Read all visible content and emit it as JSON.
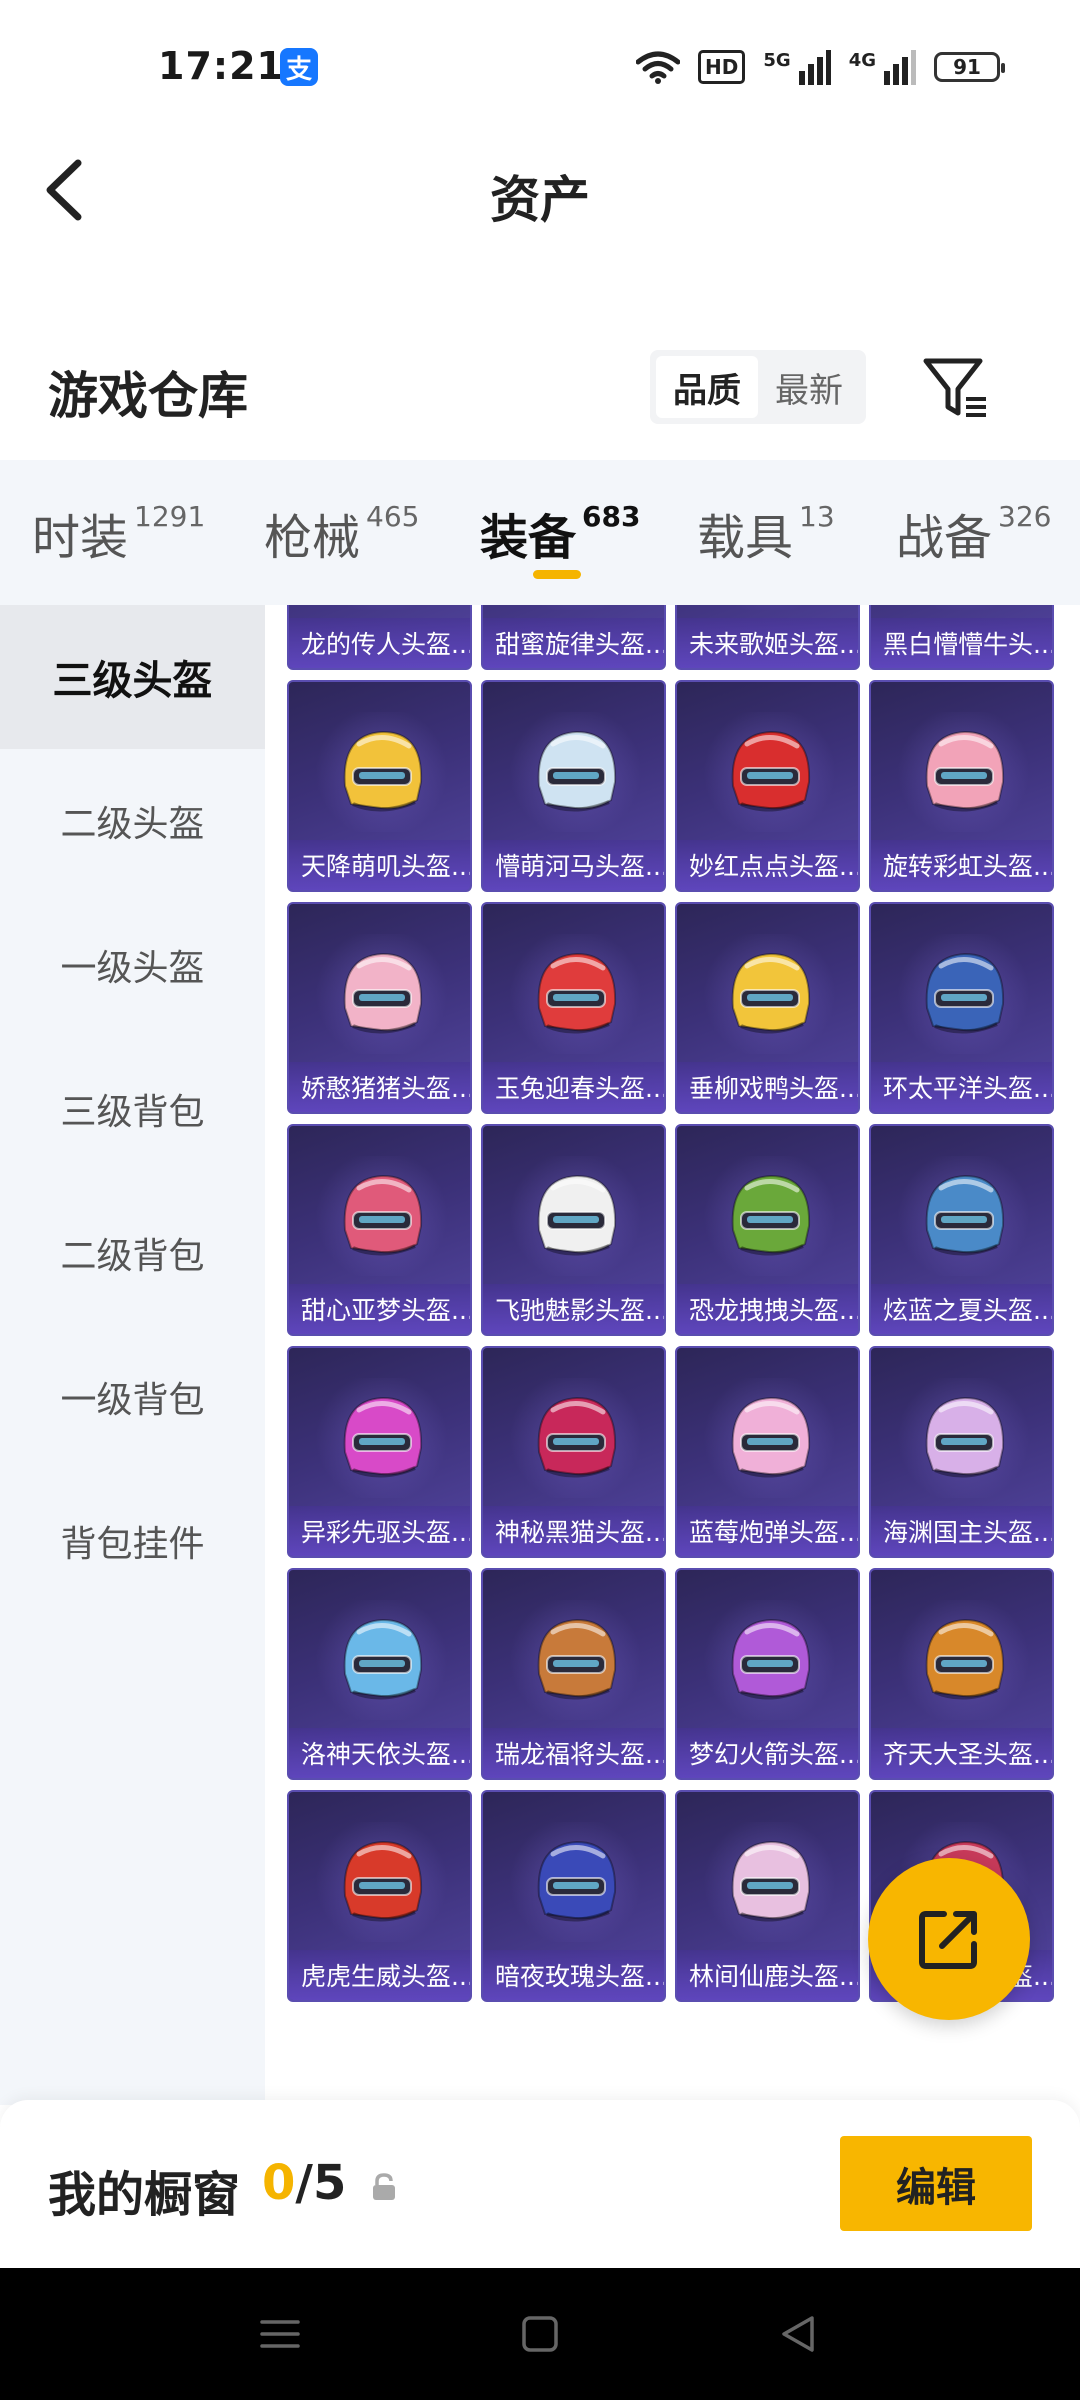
{
  "status_bar": {
    "time": "17:21",
    "alipay_label": "支",
    "hd_label": "HD",
    "net_5g": "5G",
    "net_4g": "4G",
    "battery": "91"
  },
  "header": {
    "title": "资产"
  },
  "section": {
    "title": "游戏仓库",
    "sort_options": [
      "品质",
      "最新"
    ],
    "active_sort": "品质"
  },
  "category_tabs": [
    {
      "name": "时装",
      "count": "1291"
    },
    {
      "name": "枪械",
      "count": "465"
    },
    {
      "name": "装备",
      "count": "683",
      "active": true
    },
    {
      "name": "载具",
      "count": "13"
    },
    {
      "name": "战备",
      "count": "326"
    }
  ],
  "sidebar": {
    "items": [
      "三级头盔",
      "二级头盔",
      "一级头盔",
      "三级背包",
      "二级背包",
      "一级背包",
      "背包挂件"
    ],
    "active": "三级头盔"
  },
  "items": [
    {
      "label": "龙的传人头盔...",
      "color": "#d04a3a"
    },
    {
      "label": "甜蜜旋律头盔...",
      "color": "#e8a0d8"
    },
    {
      "label": "未来歌姬头盔...",
      "color": "#e6e8f0"
    },
    {
      "label": "黑白懵懵牛头...",
      "color": "#f2f2f2"
    },
    {
      "label": "天降萌叽头盔...",
      "color": "#f2c23a"
    },
    {
      "label": "懵萌河马头盔...",
      "color": "#cfe3f2"
    },
    {
      "label": "妙红点点头盔...",
      "color": "#d92e2e"
    },
    {
      "label": "旋转彩虹头盔...",
      "color": "#f2a3b8"
    },
    {
      "label": "娇憨猪猪头盔...",
      "color": "#f2b3c8"
    },
    {
      "label": "玉兔迎春头盔...",
      "color": "#e03c3c"
    },
    {
      "label": "垂柳戏鸭头盔...",
      "color": "#f2c53a"
    },
    {
      "label": "环太平洋头盔...",
      "color": "#3a64b8"
    },
    {
      "label": "甜心亚梦头盔...",
      "color": "#e05a7a"
    },
    {
      "label": "飞驰魅影头盔...",
      "color": "#f0f0f0"
    },
    {
      "label": "恐龙拽拽头盔...",
      "color": "#6aa83a"
    },
    {
      "label": "炫蓝之夏头盔...",
      "color": "#4a8ac8"
    },
    {
      "label": "异彩先驱头盔...",
      "color": "#d84ac8"
    },
    {
      "label": "神秘黑猫头盔...",
      "color": "#c8285a"
    },
    {
      "label": "蓝莓炮弹头盔...",
      "color": "#f0b0d8"
    },
    {
      "label": "海渊国主头盔...",
      "color": "#d8b0e8"
    },
    {
      "label": "洛神天依头盔...",
      "color": "#6ab8e8"
    },
    {
      "label": "瑞龙福将头盔...",
      "color": "#c87a3a"
    },
    {
      "label": "梦幻火箭头盔...",
      "color": "#b05ad8"
    },
    {
      "label": "齐天大圣头盔...",
      "color": "#d8882a"
    },
    {
      "label": "虎虎生威头盔...",
      "color": "#d83a2a"
    },
    {
      "label": "暗夜玫瑰头盔...",
      "color": "#3a4ab8"
    },
    {
      "label": "林间仙鹿头盔...",
      "color": "#e8c0e0"
    },
    {
      "label": "枪炮玫瑰头盔...",
      "color": "#c83a5a"
    }
  ],
  "bottom_bar": {
    "title": "我的橱窗",
    "used": "0",
    "separator": "/",
    "total": "5",
    "edit_label": "编辑"
  },
  "colors": {
    "accent": "#f8b600",
    "card_bg": "#3c3179",
    "label_bg": "#5f46be"
  }
}
